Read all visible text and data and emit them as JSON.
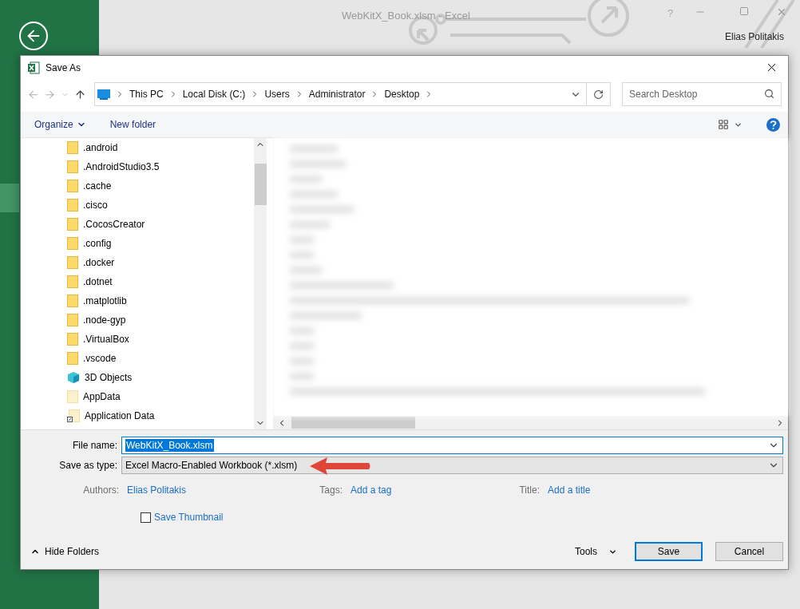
{
  "app": {
    "title": "WebKitX_Book.xlsm - Excel",
    "help": "?",
    "user": "Elias Politakis"
  },
  "dialog": {
    "title": "Save As",
    "breadcrumb": [
      "This PC",
      "Local Disk (C:)",
      "Users",
      "Administrator",
      "Desktop"
    ],
    "search": {
      "placeholder": "Search Desktop"
    },
    "toolbar": {
      "organize": "Organize",
      "new_folder": "New folder"
    },
    "folders": [
      {
        "name": ".android",
        "kind": "folder"
      },
      {
        "name": ".AndroidStudio3.5",
        "kind": "folder"
      },
      {
        "name": ".cache",
        "kind": "folder"
      },
      {
        "name": ".cisco",
        "kind": "folder"
      },
      {
        "name": ".CocosCreator",
        "kind": "folder"
      },
      {
        "name": ".config",
        "kind": "folder"
      },
      {
        "name": ".docker",
        "kind": "folder"
      },
      {
        "name": ".dotnet",
        "kind": "folder"
      },
      {
        "name": ".matplotlib",
        "kind": "folder"
      },
      {
        "name": ".node-gyp",
        "kind": "folder"
      },
      {
        "name": ".VirtualBox",
        "kind": "folder"
      },
      {
        "name": ".vscode",
        "kind": "folder"
      },
      {
        "name": "3D Objects",
        "kind": "objects3d"
      },
      {
        "name": "AppData",
        "kind": "hidden"
      },
      {
        "name": "Application Data",
        "kind": "shortcut"
      }
    ],
    "file_name": {
      "label": "File name:",
      "value": "WebKitX_Book.xlsm",
      "text_selected": true
    },
    "save_as_type": {
      "label": "Save as type:",
      "value": "Excel Macro-Enabled Workbook (*.xlsm)"
    },
    "meta": [
      {
        "label": "Authors:",
        "value": "Elias Politakis"
      },
      {
        "label": "Tags:",
        "value": "Add a tag"
      },
      {
        "label": "Title:",
        "value": "Add a title"
      }
    ],
    "save_thumbnail": {
      "label": "Save Thumbnail",
      "checked": false
    },
    "hide_folders": "Hide Folders",
    "tools": "Tools",
    "buttons": [
      {
        "label": "Save",
        "default": true
      },
      {
        "label": "Cancel",
        "default": false
      }
    ]
  }
}
